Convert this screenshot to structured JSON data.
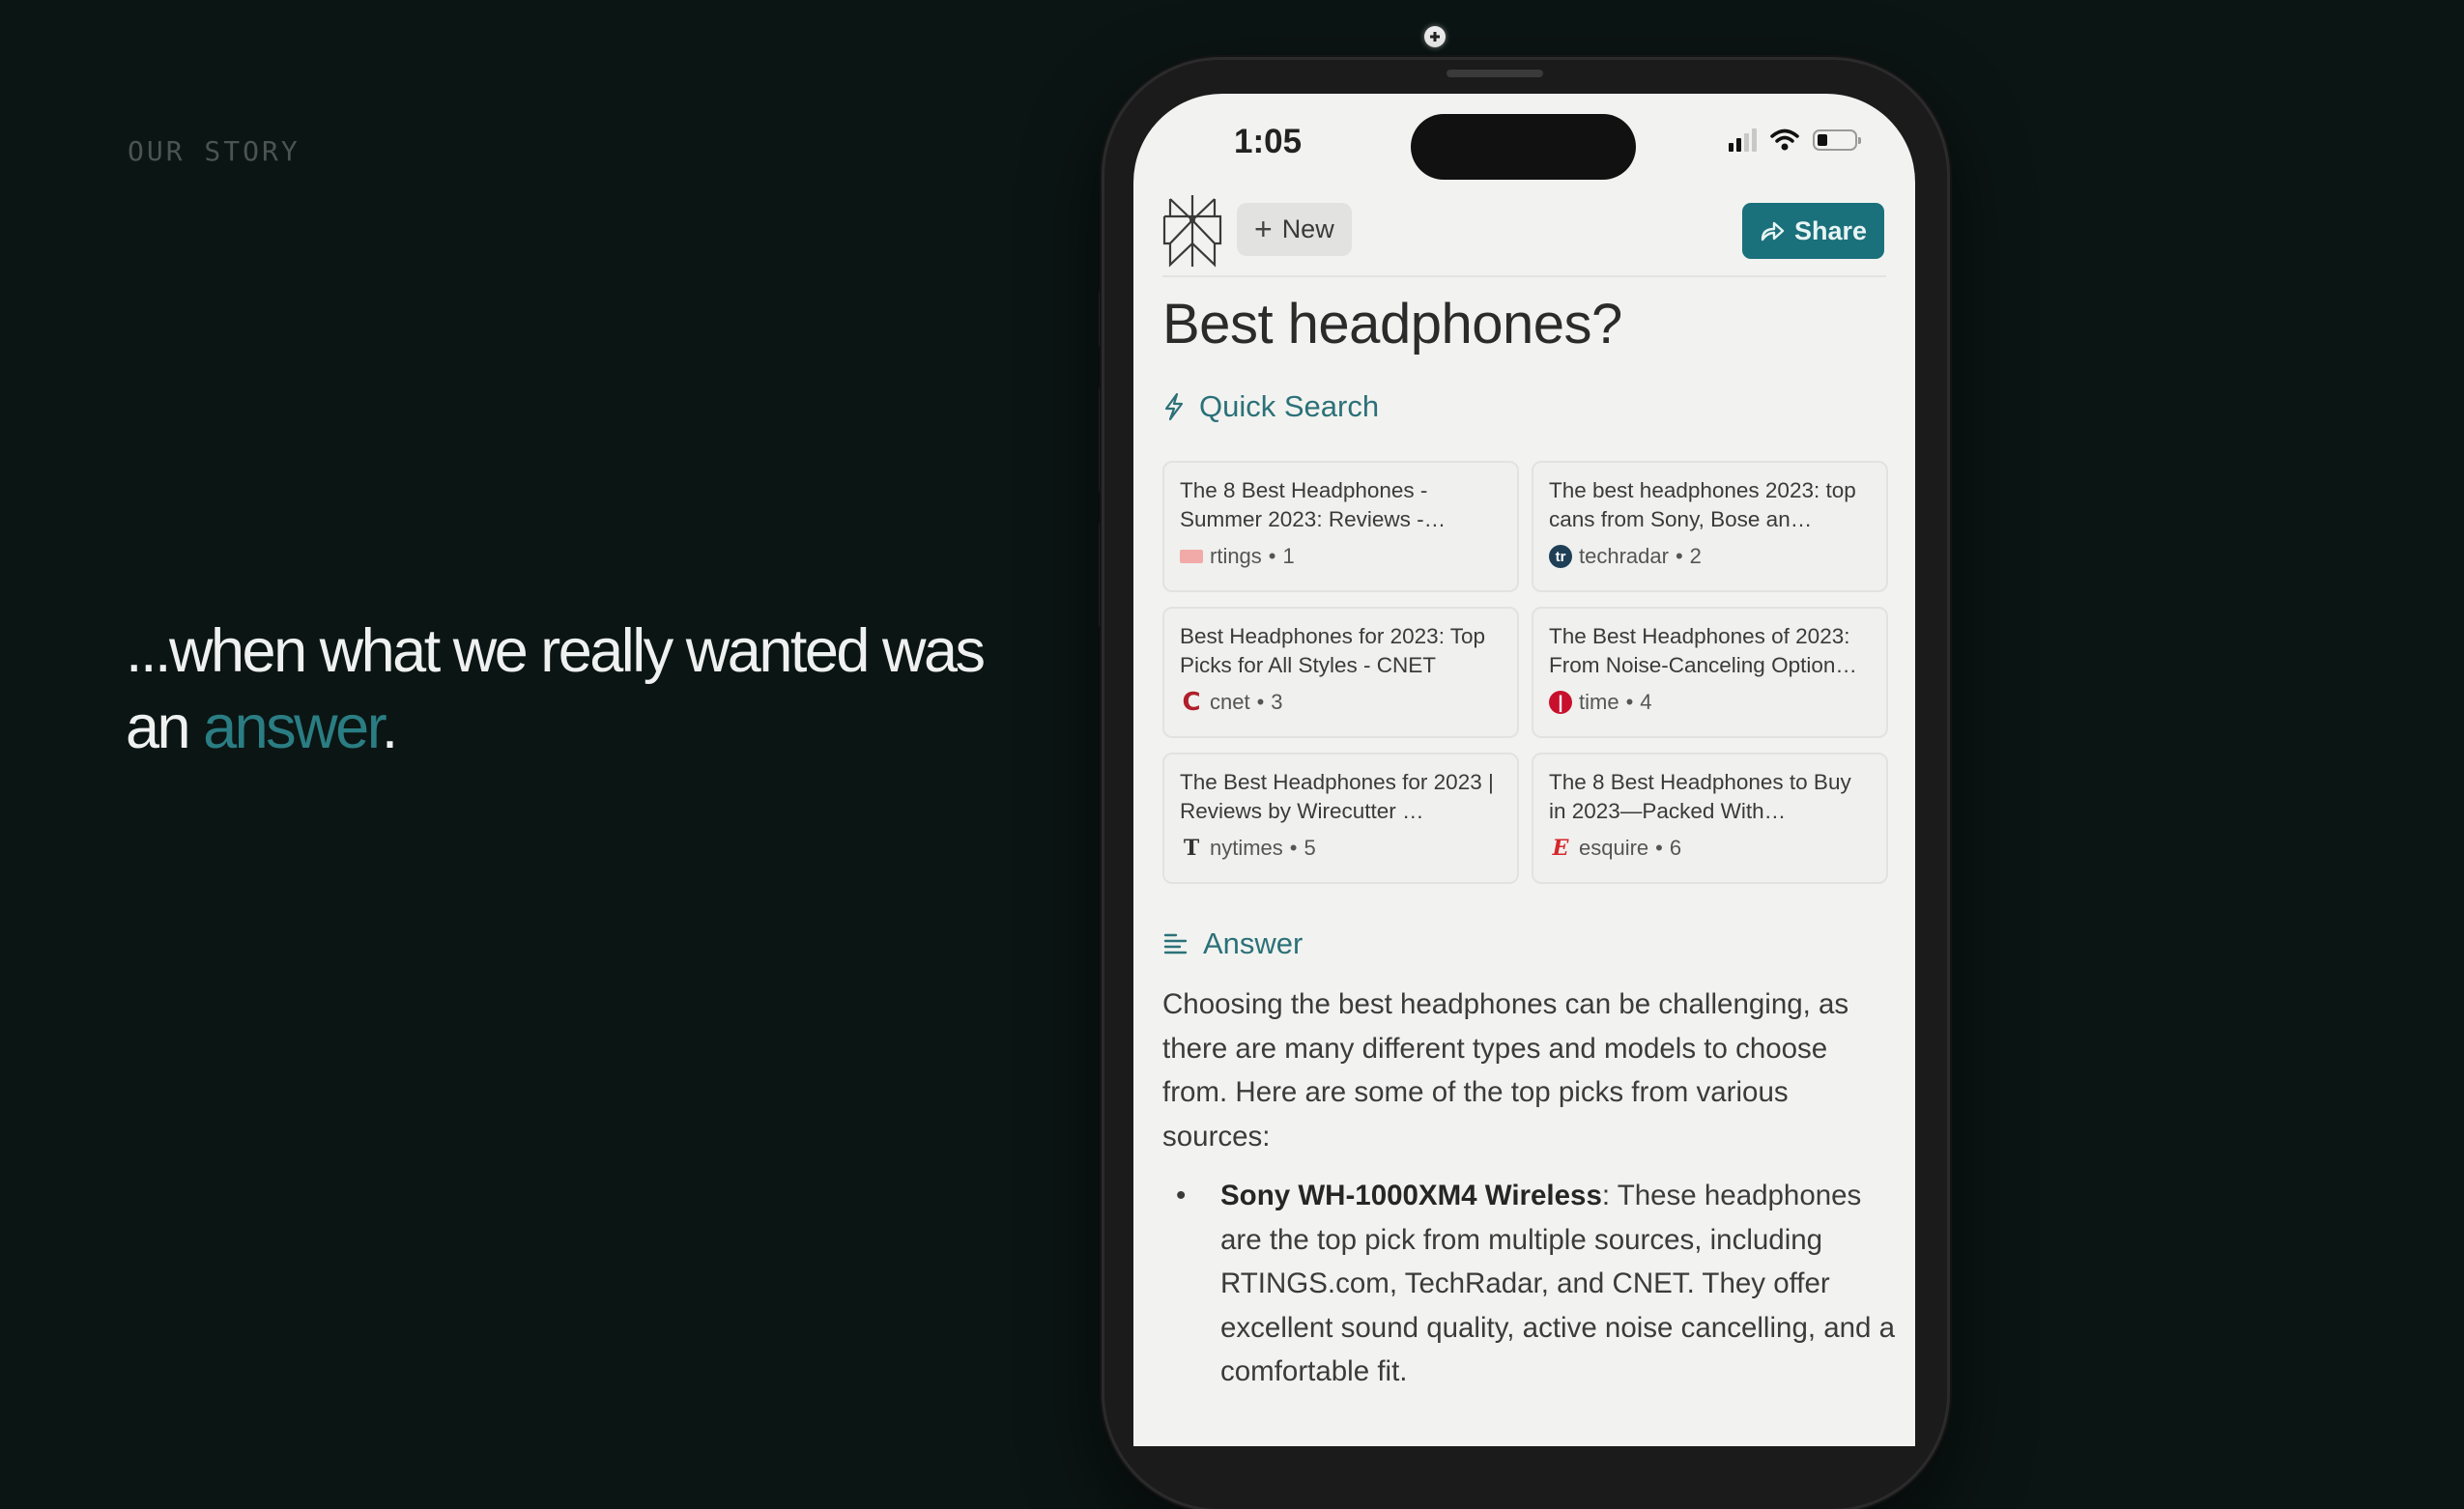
{
  "slide": {
    "eyebrow": "OUR STORY",
    "headline_part1": "...when what we really wanted was an ",
    "headline_accent": "answer",
    "headline_end": ".",
    "accent_color": "#2a7d83"
  },
  "phone": {
    "status_bar": {
      "time": "1:05",
      "signal_bars_active": 2,
      "signal_bars_total": 4,
      "battery_level": 0.25
    },
    "header": {
      "logo_icon": "perplexity-logo-icon",
      "new_label": "New",
      "share_label": "Share",
      "share_color": "#1a707b"
    },
    "query_title": "Best headphones?",
    "quick_search": {
      "label": "Quick Search",
      "icon": "lightning-icon",
      "results": [
        {
          "title": "The 8 Best Headphones - Summer 2023: Reviews -…",
          "source": "rtings",
          "index": "1",
          "icon": "rtings"
        },
        {
          "title": "The best headphones 2023: top cans from Sony, Bose an…",
          "source": "techradar",
          "index": "2",
          "icon": "techradar"
        },
        {
          "title": "Best Headphones for 2023: Top Picks for All Styles - CNET",
          "source": "cnet",
          "index": "3",
          "icon": "cnet"
        },
        {
          "title": "The Best Headphones of 2023: From Noise-Canceling Option…",
          "source": "time",
          "index": "4",
          "icon": "time"
        },
        {
          "title": "The Best Headphones for 2023 | Reviews by Wirecutter …",
          "source": "nytimes",
          "index": "5",
          "icon": "nytimes"
        },
        {
          "title": "The 8 Best Headphones to Buy in 2023—Packed With…",
          "source": "esquire",
          "index": "6",
          "icon": "esquire"
        }
      ]
    },
    "answer": {
      "label": "Answer",
      "icon": "text-lines-icon",
      "intro": "Choosing the best headphones can be challenging, as there are many different types and models to choose from. Here are some of the top picks from various sources:",
      "items": [
        {
          "bold": "Sony WH-1000XM4 Wireless",
          "text": ": These headphones are the top pick from multiple sources, including RTINGS.com, TechRadar, and CNET. They offer excellent sound quality, active noise cancelling, and a comfortable fit."
        }
      ]
    }
  }
}
